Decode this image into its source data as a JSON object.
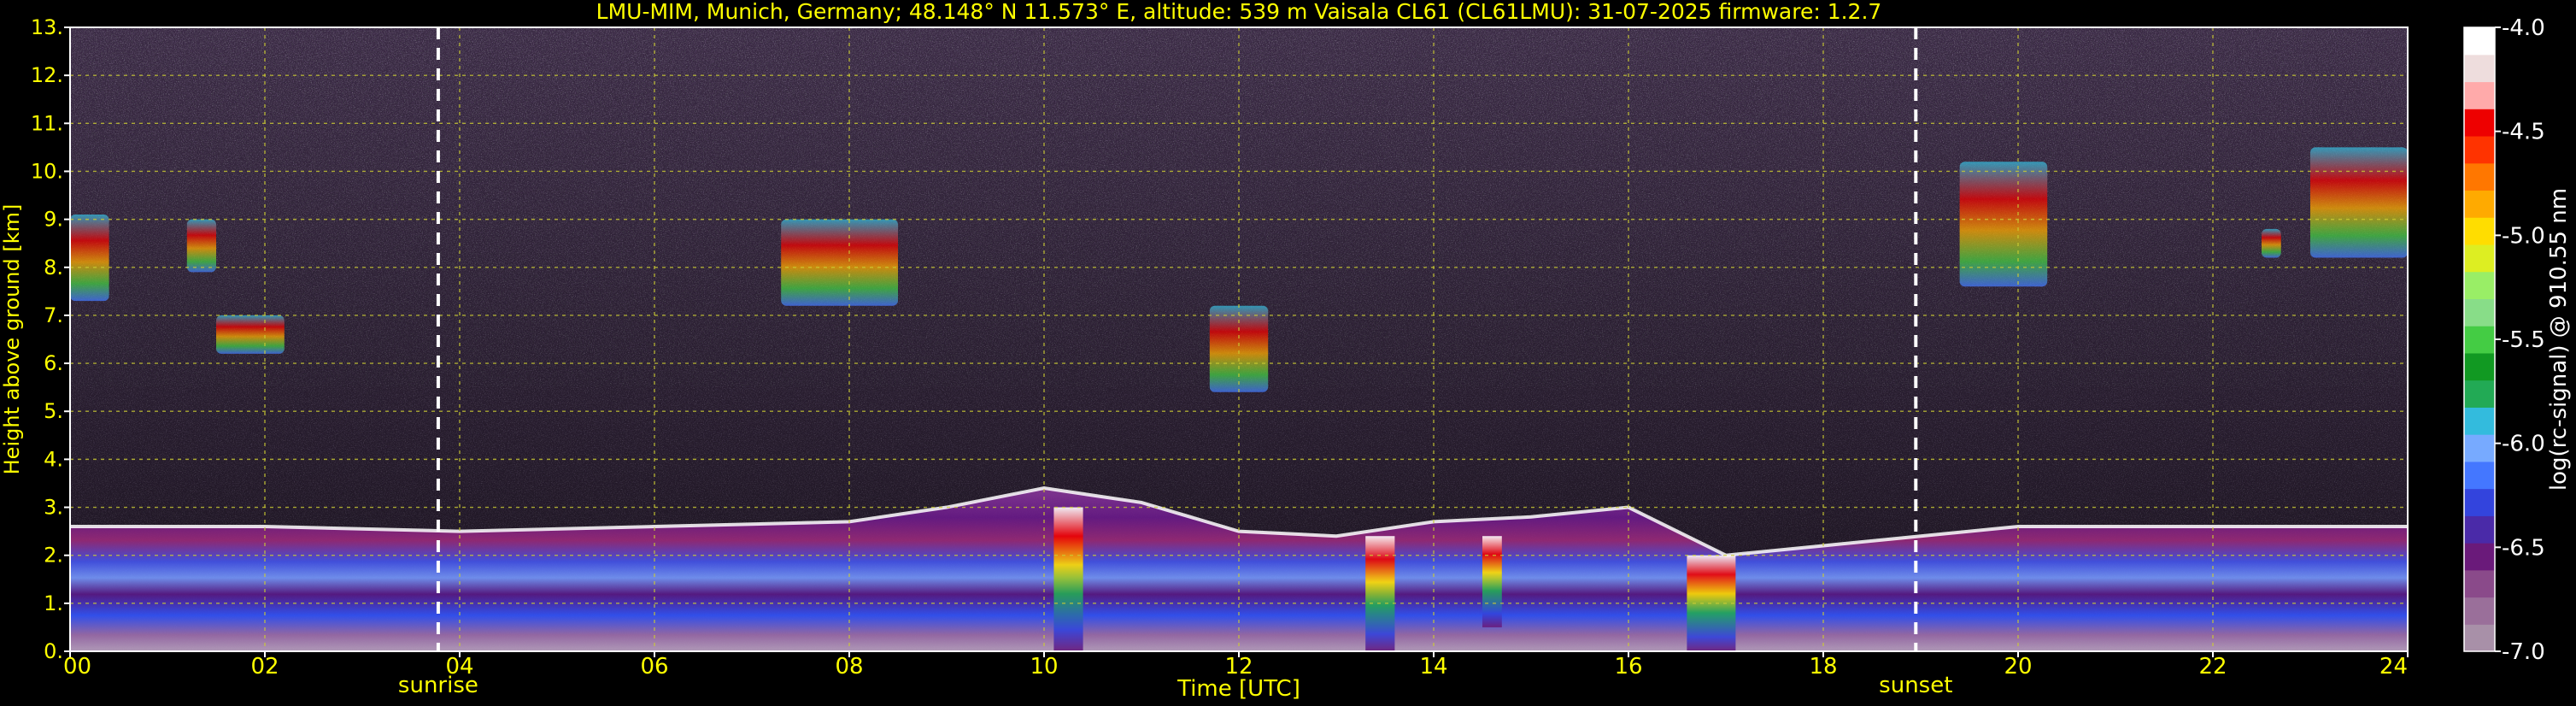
{
  "title": "LMU-MIM, Munich, Germany; 48.148° N 11.573° E, altitude: 539 m    Vaisala CL61 (CL61LMU): 31-07-2025    firmware: 1.2.7",
  "chart_data": {
    "type": "heatmap",
    "title": "LMU-MIM, Munich, Germany; 48.148° N 11.573° E, altitude: 539 m    Vaisala CL61 (CL61LMU): 31-07-2025    firmware: 1.2.7",
    "xlabel": "Time [UTC]",
    "ylabel": "Height above ground [km]",
    "xlim": [
      0,
      24
    ],
    "ylim": [
      0,
      13
    ],
    "x_ticks": [
      0,
      2,
      4,
      6,
      8,
      10,
      12,
      14,
      16,
      18,
      20,
      22,
      24
    ],
    "x_tick_labels": [
      "00",
      "02",
      "04",
      "06",
      "08",
      "10",
      "12",
      "14",
      "16",
      "18",
      "20",
      "22",
      "24"
    ],
    "y_ticks": [
      0,
      1,
      2,
      3,
      4,
      5,
      6,
      7,
      8,
      9,
      10,
      11,
      12,
      13
    ],
    "y_tick_labels": [
      "0.",
      "1.",
      "2.",
      "3.",
      "4.",
      "5.",
      "6.",
      "7.",
      "8.",
      "9.",
      "10.",
      "11.",
      "12.",
      "13."
    ],
    "grid": true,
    "colorbar": {
      "label": "log(rc-signal) @ 910.55 nm",
      "min": -7.0,
      "max": -4.0,
      "ticks": [
        -7.0,
        -6.5,
        -6.0,
        -5.5,
        -5.0,
        -4.5,
        -4.0
      ],
      "tick_labels": [
        "-7.0",
        "-6.5",
        "-6.0",
        "-5.5",
        "-5.0",
        "-4.5",
        "-4.0"
      ],
      "colors": [
        "#a890a8",
        "#9a6f9a",
        "#8a4a8a",
        "#6a1a7a",
        "#4a2aa8",
        "#3344dd",
        "#4477ff",
        "#77aaff",
        "#33bbdd",
        "#22aa55",
        "#119922",
        "#44cc44",
        "#88dd88",
        "#99ee66",
        "#ddee22",
        "#ffdd00",
        "#ffaa00",
        "#ff7700",
        "#ff3300",
        "#ee0000",
        "#ffaaaa",
        "#eedddd",
        "#ffffff"
      ]
    },
    "annotations": [
      {
        "text": "sunrise",
        "x": 3.78
      },
      {
        "text": "sunset",
        "x": 18.95
      }
    ],
    "features": {
      "boundary_layer_top_km": [
        {
          "x": 0,
          "y": 2.6
        },
        {
          "x": 2,
          "y": 2.6
        },
        {
          "x": 4,
          "y": 2.5
        },
        {
          "x": 6,
          "y": 2.6
        },
        {
          "x": 8,
          "y": 2.7
        },
        {
          "x": 9,
          "y": 3.0
        },
        {
          "x": 10,
          "y": 3.4
        },
        {
          "x": 11,
          "y": 3.1
        },
        {
          "x": 12,
          "y": 2.5
        },
        {
          "x": 13,
          "y": 2.4
        },
        {
          "x": 14,
          "y": 2.7
        },
        {
          "x": 15,
          "y": 2.8
        },
        {
          "x": 16,
          "y": 3.0
        },
        {
          "x": 17,
          "y": 2.0
        },
        {
          "x": 18,
          "y": 2.2
        },
        {
          "x": 19,
          "y": 2.4
        },
        {
          "x": 20,
          "y": 2.6
        },
        {
          "x": 22,
          "y": 2.6
        },
        {
          "x": 24,
          "y": 2.6
        }
      ],
      "cirrus_layers": [
        {
          "x_start": 0.0,
          "x_end": 0.4,
          "y_low": 7.3,
          "y_high": 9.1
        },
        {
          "x_start": 1.2,
          "x_end": 1.5,
          "y_low": 7.9,
          "y_high": 9.0
        },
        {
          "x_start": 1.5,
          "x_end": 2.2,
          "y_low": 6.2,
          "y_high": 7.0
        },
        {
          "x_start": 7.3,
          "x_end": 8.5,
          "y_low": 7.2,
          "y_high": 9.0
        },
        {
          "x_start": 11.7,
          "x_end": 12.3,
          "y_low": 5.4,
          "y_high": 7.2
        },
        {
          "x_start": 19.4,
          "x_end": 20.3,
          "y_low": 7.6,
          "y_high": 10.2
        },
        {
          "x_start": 22.5,
          "x_end": 22.7,
          "y_low": 8.2,
          "y_high": 8.8
        },
        {
          "x_start": 23.0,
          "x_end": 24.0,
          "y_low": 8.2,
          "y_high": 10.5
        }
      ],
      "low_cloud_columns": [
        {
          "x_start": 10.1,
          "x_end": 10.4,
          "y_low": 0.0,
          "y_high": 3.0
        },
        {
          "x_start": 13.3,
          "x_end": 13.6,
          "y_low": 0.0,
          "y_high": 2.4
        },
        {
          "x_start": 14.5,
          "x_end": 14.7,
          "y_low": 0.5,
          "y_high": 2.4
        },
        {
          "x_start": 16.6,
          "x_end": 17.1,
          "y_low": 0.0,
          "y_high": 2.0
        }
      ]
    }
  }
}
